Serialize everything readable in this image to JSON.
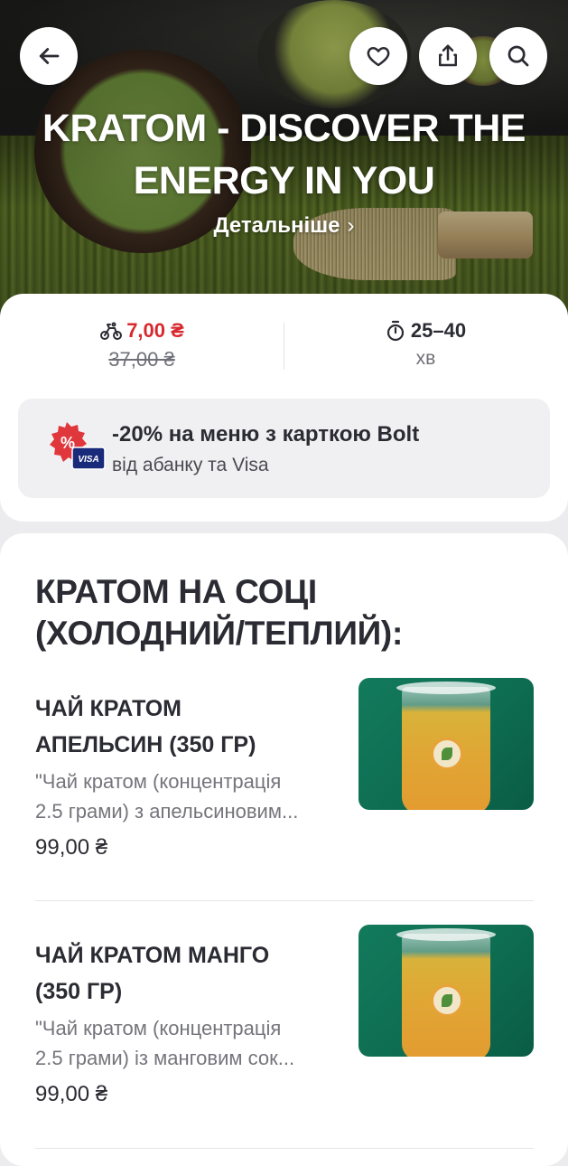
{
  "hero": {
    "title_line1": "KRATOM - DISCOVER THE",
    "title_line2": "ENERGY IN YOU",
    "more_label": "Детальніше",
    "more_chevron": "›"
  },
  "header": {
    "back_icon": "arrow-left-icon",
    "favorite_icon": "heart-icon",
    "share_icon": "share-icon",
    "search_icon": "search-icon"
  },
  "delivery": {
    "icon": "courier-bike-icon",
    "price": "7,00 ₴",
    "old_price": "37,00 ₴",
    "accent_color": "#d8282f"
  },
  "time": {
    "icon": "stopwatch-icon",
    "range": "25–40",
    "unit": "хв"
  },
  "promo": {
    "icon": "discount-visa-badge-icon",
    "title": "-20% на меню з карткою Bolt",
    "subtitle": "від абанку та Visa",
    "badge_text": "VISA"
  },
  "menu": {
    "section_title_line1": "КРАТОМ НА СОЦІ",
    "section_title_line2": "(ХОЛОДНИЙ/ТЕПЛИЙ):",
    "items": [
      {
        "name_line1": "ЧАЙ КРАТОМ",
        "name_line2": "АПЕЛЬСИН (350 ГР)",
        "desc_line1": "\"Чай кратом (концентрація",
        "desc_line2": "2.5 грами) з апельсиновим...",
        "price": "99,00 ₴"
      },
      {
        "name_line1": "ЧАЙ КРАТОМ МАНГО",
        "name_line2": "(350 ГР)",
        "desc_line1": "\"Чай кратом (концентрація",
        "desc_line2": "2.5 грами) із манговим сок...",
        "price": "99,00 ₴"
      }
    ]
  }
}
